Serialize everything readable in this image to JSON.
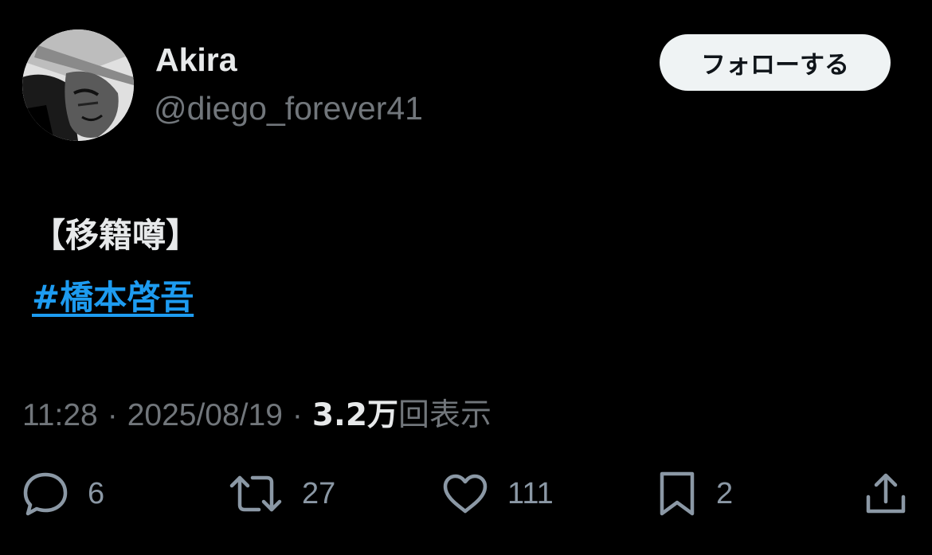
{
  "user": {
    "display_name": "Akira",
    "handle": "@diego_forever41"
  },
  "follow_button": {
    "label": "フォローする"
  },
  "tweet": {
    "text": "【移籍噂】",
    "hashtag": "#橋本啓吾"
  },
  "meta": {
    "time": "11:28",
    "separator": "·",
    "date": "2025/08/19",
    "views_count": "3.2万",
    "views_label": "回表示"
  },
  "actions": {
    "reply_count": "6",
    "retweet_count": "27",
    "like_count": "111",
    "bookmark_count": "2"
  },
  "icons": {
    "reply": "reply-icon",
    "retweet": "retweet-icon",
    "like": "heart-icon",
    "bookmark": "bookmark-icon",
    "share": "share-icon"
  },
  "colors": {
    "background": "#000000",
    "text_primary": "#e7e9ea",
    "text_secondary": "#71767b",
    "link": "#1d9bf0",
    "follow_bg": "#eff3f4"
  }
}
